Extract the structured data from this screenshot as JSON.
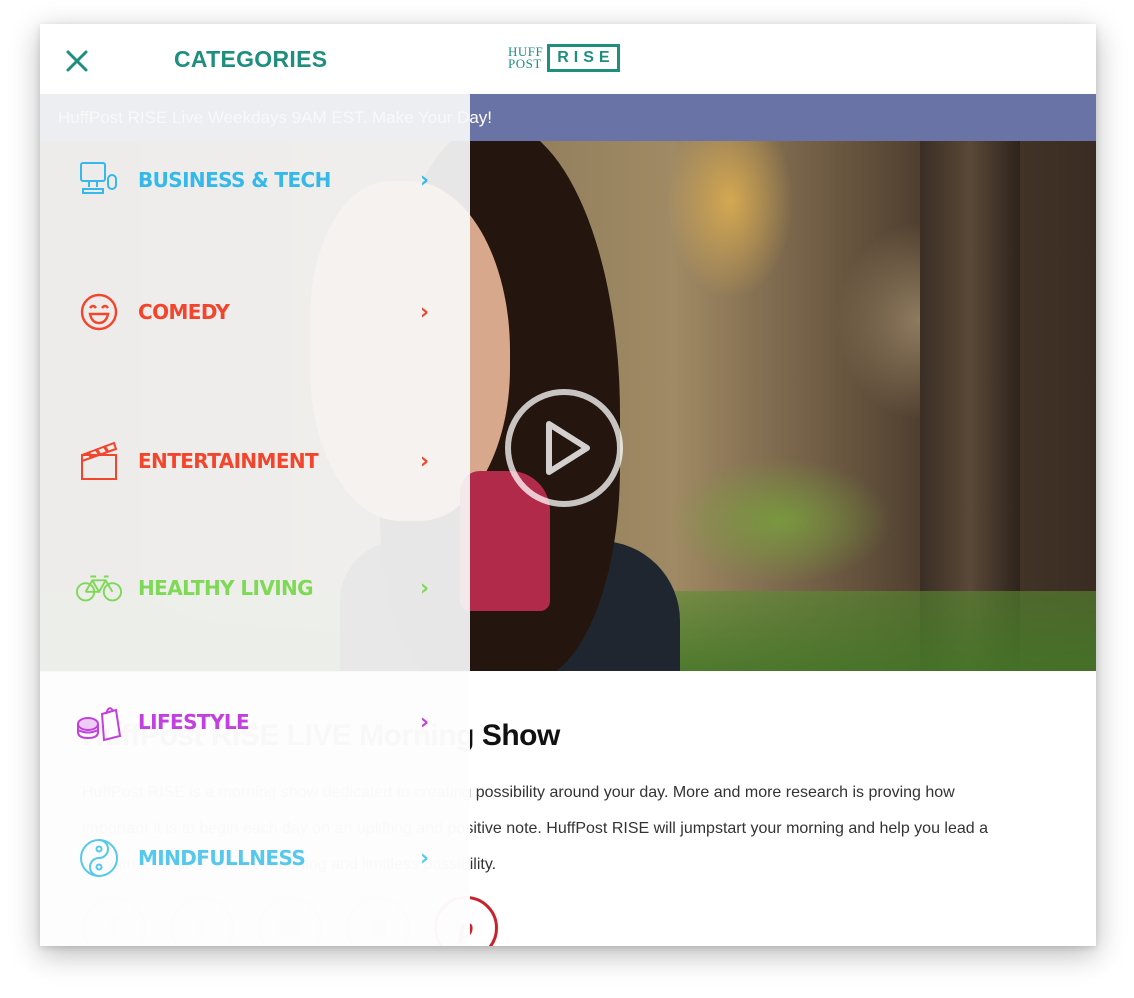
{
  "header": {
    "logo_huff": "HUFF",
    "logo_post": "POST",
    "logo_rise": "RISE"
  },
  "banner": {
    "text": "HuffPost RISE Live Weekdays 9AM EST. Make Your Day!"
  },
  "video": {
    "play_icon": "play-icon"
  },
  "article": {
    "title": "HuffPost RISE LIVE Morning Show",
    "body": "HuffPost RISE is a morning show dedicated to creating possibility around your day. More and more research is proving how important it is to begin each day on an uplifting and positive note. HuffPost RISE will jumpstart your morning and help you lead a life with less stress, more meaning and limitless possibility.",
    "share": [
      {
        "name": "facebook-icon",
        "glyph": "f"
      },
      {
        "name": "twitter-icon",
        "glyph": "t"
      },
      {
        "name": "email-icon",
        "glyph": "✉"
      },
      {
        "name": "comment-icon",
        "glyph": "■"
      },
      {
        "name": "pinterest-icon",
        "glyph": "p"
      }
    ]
  },
  "drawer": {
    "title": "CATEGORIES",
    "close_icon": "close-icon",
    "items": [
      {
        "label": "BUSINESS & TECH",
        "color": "#35b8ea",
        "icon": "computer-icon"
      },
      {
        "label": "COMEDY",
        "color": "#f2452c",
        "icon": "smiley-icon"
      },
      {
        "label": "ENTERTAINMENT",
        "color": "#f2452c",
        "icon": "clapperboard-icon"
      },
      {
        "label": "HEALTHY LIVING",
        "color": "#7ed957",
        "icon": "bicycle-icon"
      },
      {
        "label": "LIFESTYLE",
        "color": "#c23fe0",
        "icon": "shopping-icon"
      },
      {
        "label": "MINDFULLNESS",
        "color": "#56c8ee",
        "icon": "yin-yang-icon"
      }
    ],
    "chevron": "›"
  }
}
